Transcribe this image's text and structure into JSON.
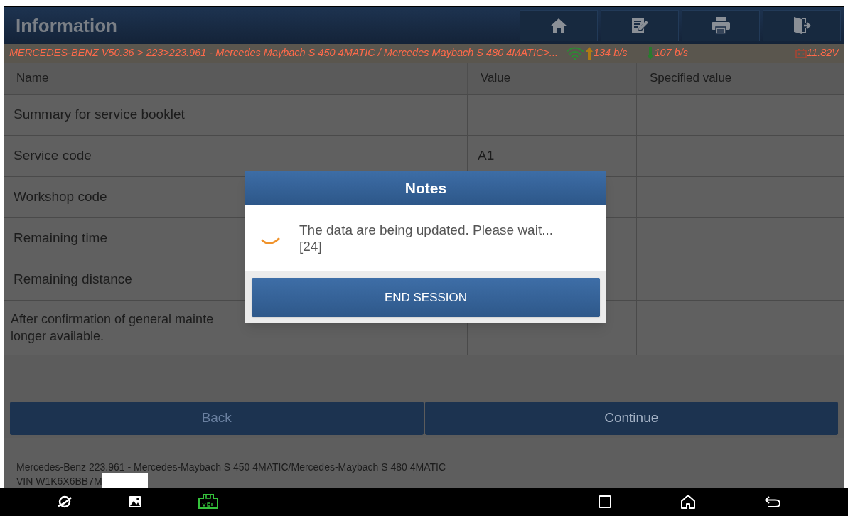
{
  "header": {
    "title": "Information",
    "toolbar": [
      {
        "kind": "home"
      },
      {
        "kind": "edit"
      },
      {
        "kind": "print"
      },
      {
        "kind": "exit"
      }
    ]
  },
  "status_bar": {
    "breadcrumb": "MERCEDES-BENZ V50.36 > 223>223.961 - Mercedes Maybach S 450 4MATIC / Mercedes Maybach S 480 4MATIC>...",
    "upload": "134 b/s",
    "download": "107 b/s",
    "battery": "11.82V"
  },
  "table": {
    "columns": [
      "Name",
      "Value",
      "Specified value"
    ],
    "rows": [
      {
        "name": "Summary for service booklet",
        "value": ""
      },
      {
        "name": "Service code",
        "value": "A1"
      },
      {
        "name": "Workshop code",
        "value": ""
      },
      {
        "name": "Remaining time",
        "value": ""
      },
      {
        "name": "Remaining distance",
        "value": ""
      },
      {
        "name": "After confirmation of general mainte\nlonger available.",
        "value": ""
      }
    ]
  },
  "buttons": [
    {
      "label": "Back",
      "disabled": true
    },
    {
      "label": "Continue",
      "disabled": false
    }
  ],
  "footer": {
    "vehicle": "Mercedes-Benz 223.961 - Mercedes-Maybach S 450 4MATIC/Mercedes-Maybach S 480 4MATIC",
    "vin": "VIN W1K6X6BB7M"
  },
  "dialog": {
    "title": "Notes",
    "message": "The data are being updated. Please wait...\n[24]",
    "button": "END SESSION"
  },
  "nav_bar": {
    "left": [
      {
        "kind": "browser"
      },
      {
        "kind": "gallery"
      },
      {
        "kind": "vci"
      }
    ],
    "right": [
      {
        "kind": "recents"
      },
      {
        "kind": "home"
      },
      {
        "kind": "back"
      }
    ]
  }
}
